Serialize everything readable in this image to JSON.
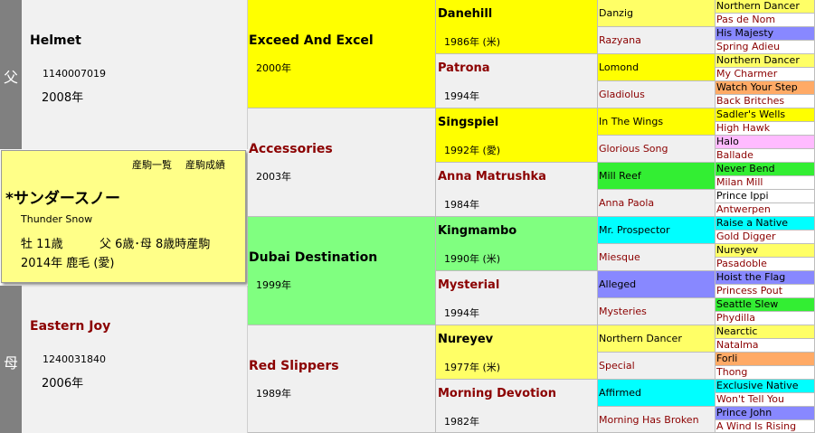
{
  "sire_label": "父",
  "dam_label": "母",
  "sire": {
    "name": "Helmet",
    "id": "1140007019",
    "year": "2008年"
  },
  "dam": {
    "name": "Eastern Joy",
    "id": "1240031840",
    "year": "2006年"
  },
  "horse": {
    "links": [
      "産駒一覧",
      "産駒成績"
    ],
    "name": "*サンダースノー",
    "name_en": "Thunder Snow",
    "info1": "牡 11歳",
    "info2": "父 6歳･母 8歳時産駒",
    "info3": "2014年 鹿毛 (愛)"
  },
  "gen1": [
    {
      "name": "Exceed And Excel",
      "year": "2000年",
      "color": "yellow",
      "red": false
    },
    {
      "name": "Accessories",
      "year": "2003年",
      "color": "gray",
      "red": true
    },
    {
      "name": "Dubai Destination",
      "year": "1999年",
      "color": "lgreen",
      "red": false
    },
    {
      "name": "Red Slippers",
      "year": "1989年",
      "color": "gray",
      "red": true
    }
  ],
  "gen2": [
    {
      "name": "Danehill",
      "year": "1986年 (米)",
      "color": "yellow",
      "red": false
    },
    {
      "name": "Patrona",
      "year": "1994年",
      "color": "gray",
      "red": true
    },
    {
      "name": "Singspiel",
      "year": "1992年 (愛)",
      "color": "yellow",
      "red": false
    },
    {
      "name": "Anna Matrushka",
      "year": "1984年",
      "color": "gray",
      "red": true
    },
    {
      "name": "Kingmambo",
      "year": "1990年 (米)",
      "color": "lgreen",
      "red": false
    },
    {
      "name": "Mysterial",
      "year": "1994年",
      "color": "gray",
      "red": true
    },
    {
      "name": "Nureyev",
      "year": "1977年 (米)",
      "color": "lyellow",
      "red": false
    },
    {
      "name": "Morning Devotion",
      "year": "1982年",
      "color": "gray",
      "red": true
    }
  ],
  "gen3": [
    {
      "name": "Danzig",
      "color": "lyellow",
      "red": false
    },
    {
      "name": "Razyana",
      "color": "gray",
      "red": true
    },
    {
      "name": "Lomond",
      "color": "yellow",
      "red": false
    },
    {
      "name": "Gladiolus",
      "color": "gray",
      "red": true
    },
    {
      "name": "In The Wings",
      "color": "yellow",
      "red": false
    },
    {
      "name": "Glorious Song",
      "color": "gray",
      "red": true
    },
    {
      "name": "Mill Reef",
      "color": "green",
      "red": false
    },
    {
      "name": "Anna Paola",
      "color": "gray",
      "red": true
    },
    {
      "name": "Mr. Prospector",
      "color": "cyan",
      "red": false
    },
    {
      "name": "Miesque",
      "color": "gray",
      "red": true
    },
    {
      "name": "Alleged",
      "color": "blue",
      "red": false
    },
    {
      "name": "Mysteries",
      "color": "gray",
      "red": true
    },
    {
      "name": "Northern Dancer",
      "color": "lyellow",
      "red": false
    },
    {
      "name": "Special",
      "color": "gray",
      "red": true
    },
    {
      "name": "Affirmed",
      "color": "cyan",
      "red": false
    },
    {
      "name": "Morning Has Broken",
      "color": "gray",
      "red": true
    }
  ],
  "gen4": [
    {
      "name": "Northern Dancer",
      "color": "lyellow",
      "red": false
    },
    {
      "name": "Pas de Nom",
      "color": "white",
      "red": true
    },
    {
      "name": "His Majesty",
      "color": "blue",
      "red": false
    },
    {
      "name": "Spring Adieu",
      "color": "white",
      "red": true
    },
    {
      "name": "Northern Dancer",
      "color": "lyellow",
      "red": false
    },
    {
      "name": "My Charmer",
      "color": "white",
      "red": true
    },
    {
      "name": "Watch Your Step",
      "color": "orange",
      "red": false
    },
    {
      "name": "Back Britches",
      "color": "white",
      "red": true
    },
    {
      "name": "Sadler's Wells",
      "color": "yellow",
      "red": false
    },
    {
      "name": "High Hawk",
      "color": "white",
      "red": true
    },
    {
      "name": "Halo",
      "color": "pink",
      "red": false
    },
    {
      "name": "Ballade",
      "color": "white",
      "red": true
    },
    {
      "name": "Never Bend",
      "color": "green",
      "red": false
    },
    {
      "name": "Milan Mill",
      "color": "white",
      "red": true
    },
    {
      "name": "Prince Ippi",
      "color": "white",
      "red": false
    },
    {
      "name": "Antwerpen",
      "color": "white",
      "red": true
    },
    {
      "name": "Raise a Native",
      "color": "cyan",
      "red": false
    },
    {
      "name": "Gold Digger",
      "color": "white",
      "red": true
    },
    {
      "name": "Nureyev",
      "color": "lyellow",
      "red": false
    },
    {
      "name": "Pasadoble",
      "color": "white",
      "red": true
    },
    {
      "name": "Hoist the Flag",
      "color": "blue",
      "red": false
    },
    {
      "name": "Princess Pout",
      "color": "white",
      "red": true
    },
    {
      "name": "Seattle Slew",
      "color": "green",
      "red": false
    },
    {
      "name": "Phydilla",
      "color": "white",
      "red": true
    },
    {
      "name": "Nearctic",
      "color": "lyellow",
      "red": false
    },
    {
      "name": "Natalma",
      "color": "white",
      "red": true
    },
    {
      "name": "Forli",
      "color": "orange",
      "red": false
    },
    {
      "name": "Thong",
      "color": "white",
      "red": true
    },
    {
      "name": "Exclusive Native",
      "color": "cyan",
      "red": false
    },
    {
      "name": "Won't Tell You",
      "color": "white",
      "red": true
    },
    {
      "name": "Prince John",
      "color": "blue",
      "red": false
    },
    {
      "name": "A Wind Is Rising",
      "color": "white",
      "red": true
    }
  ]
}
